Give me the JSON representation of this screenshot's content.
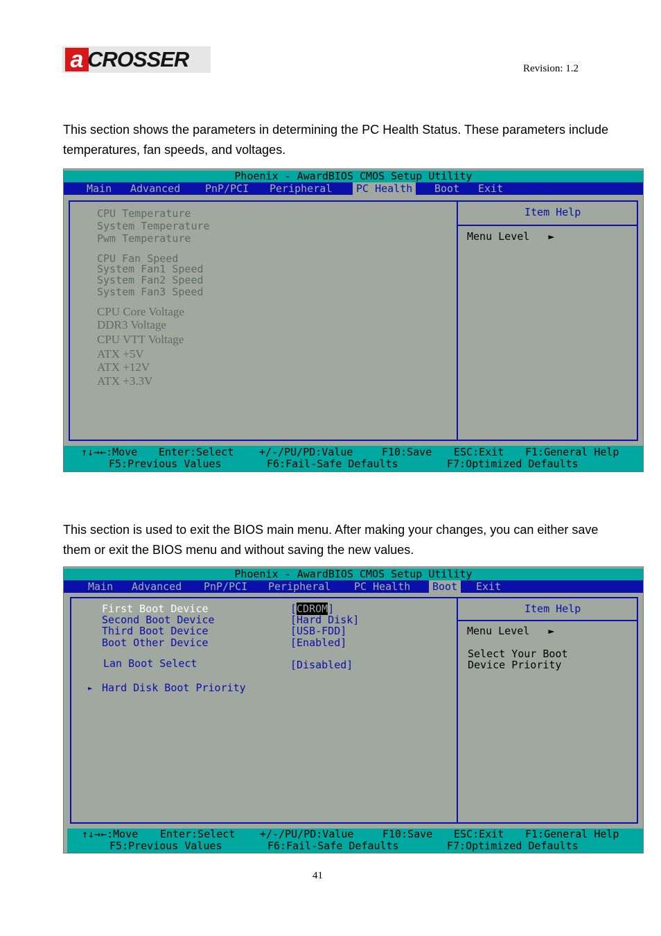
{
  "header": {
    "logo_text": "aCROSSER",
    "revision": "Revision: 1.2"
  },
  "para1": "This section shows the parameters in determining the PC Health Status. These parameters include temperatures, fan speeds, and voltages.",
  "para2": "This section is used to exit the BIOS main menu. After making your changes, you can either save them or exit the BIOS menu and without saving the new values.",
  "page_number": "41",
  "bios_title": "Phoenix - AwardBIOS CMOS Setup Utility",
  "menu": [
    "Main",
    "Advanced",
    "PnP/PCI",
    "Peripheral",
    "PC Health",
    "Boot",
    "Exit"
  ],
  "help_title": "Item Help",
  "menu_level": "Menu Level",
  "footer": {
    "move": "↑↓→←:Move",
    "select": "Enter:Select",
    "value": "+/-/PU/PD:Value",
    "save": "F10:Save",
    "exit": "ESC:Exit",
    "help": "F1:General Help",
    "prev": "F5:Previous Values",
    "failsafe": "F6:Fail-Safe Defaults",
    "optimized": "F7:Optimized Defaults"
  },
  "screen1": {
    "selected_tab": "PC Health",
    "items": [
      "CPU Temperature",
      "System Temperature",
      "Pwm Temperature",
      "CPU Fan Speed",
      "System Fan1 Speed",
      "System Fan2 Speed",
      "System Fan3 Speed",
      "CPU Core Voltage",
      "DDR3 Voltage",
      "CPU VTT Voltage",
      "ATX +5V",
      "ATX +12V",
      "ATX +3.3V"
    ]
  },
  "screen2": {
    "selected_tab": "Boot",
    "items": [
      {
        "label": "First Boot Device",
        "value_prefix": "[",
        "value": "CDROM",
        "value_suffix": "]"
      },
      {
        "label": "Second Boot Device",
        "value": "[Hard Disk]"
      },
      {
        "label": "Third Boot Device",
        "value": "[USB-FDD]"
      },
      {
        "label": "Boot Other Device",
        "value": "[Enabled]"
      },
      {
        "label": "Lan Boot Select",
        "value": "[Disabled]"
      }
    ],
    "submenu": "Hard Disk Boot Priority",
    "help_text": [
      "Select Your Boot",
      "Device Priority"
    ]
  },
  "colors": {
    "title_bar": "#00a8a0",
    "menu_bar": "#0a10a8",
    "panel": "#a0a8a0",
    "logo_red": "#d81818"
  }
}
